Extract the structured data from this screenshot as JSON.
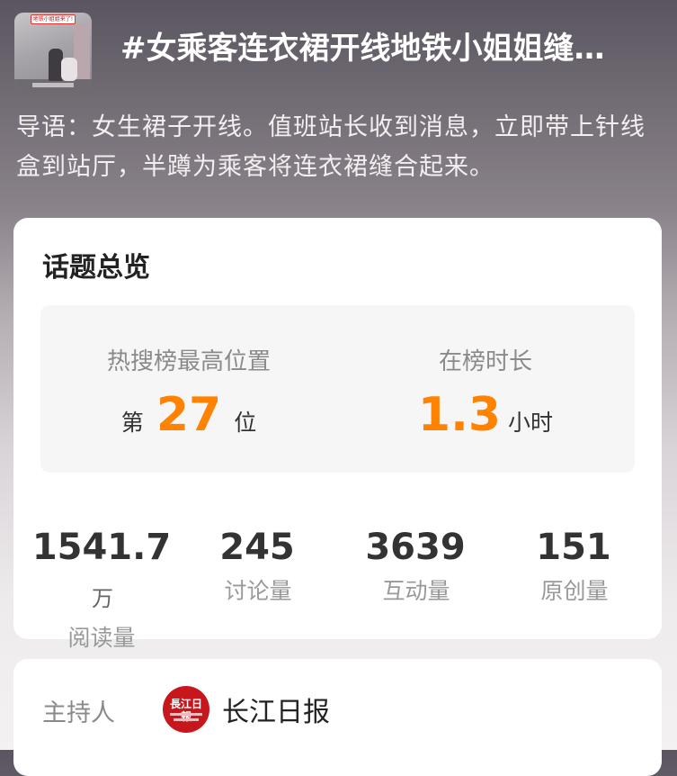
{
  "header": {
    "title": "#女乘客连衣裙开线地铁小姐姐缝…",
    "thumbnail_caption": "地铁小姐姐来了!"
  },
  "intro": "导语：女生裙子开线。值班站长收到消息，立即带上针线盒到站厅，半蹲为乘客将连衣裙缝合起来。",
  "overview": {
    "title": "话题总览",
    "rank": {
      "label": "热搜榜最高位置",
      "prefix": "第",
      "value": "27",
      "suffix": "位"
    },
    "duration": {
      "label": "在榜时长",
      "value": "1.3",
      "suffix": "小时"
    }
  },
  "metrics": [
    {
      "value": "1541.7",
      "unit": "万",
      "label": "阅读量"
    },
    {
      "value": "245",
      "unit": "",
      "label": "讨论量"
    },
    {
      "value": "3639",
      "unit": "",
      "label": "互动量"
    },
    {
      "value": "151",
      "unit": "",
      "label": "原创量"
    }
  ],
  "host": {
    "label": "主持人",
    "name": "长江日报",
    "logo_text": "長江日報"
  },
  "colors": {
    "accent": "#ff8200",
    "logo_red": "#c8161d"
  }
}
